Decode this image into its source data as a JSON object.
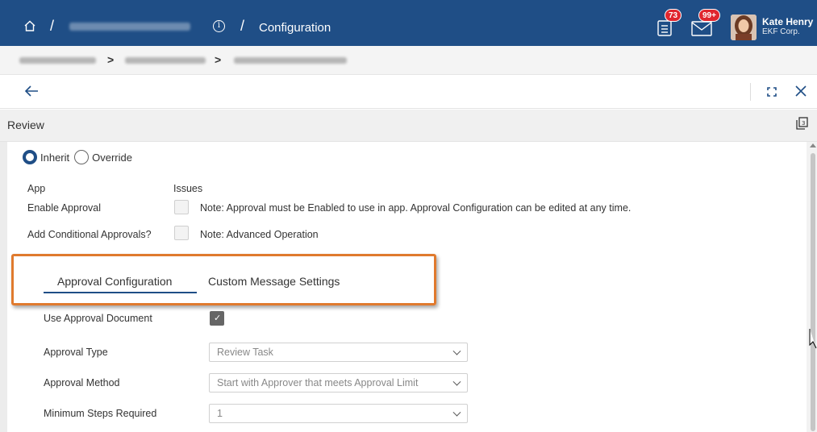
{
  "header": {
    "breadcrumb_current": "Configuration",
    "notifications_count": "73",
    "messages_count": "99+",
    "user_name": "Kate Henry",
    "user_company": "EKF Corp."
  },
  "section": {
    "title": "Review"
  },
  "inherit": {
    "inherit_label": "Inherit",
    "override_label": "Override"
  },
  "form_top": {
    "app_label": "App",
    "issues_label": "Issues",
    "enable_approval_label": "Enable Approval",
    "enable_approval_note": "Note:  Approval must be Enabled to use in app.  Approval Configuration can be edited at any time.",
    "conditional_label": "Add Conditional Approvals?",
    "conditional_note": "Note:  Advanced Operation"
  },
  "tabs": [
    {
      "label": "Approval Configuration"
    },
    {
      "label": "Custom Message Settings"
    }
  ],
  "config": {
    "use_doc_label": "Use Approval Document",
    "approval_type_label": "Approval Type",
    "approval_type_value": "Review Task",
    "approval_method_label": "Approval Method",
    "approval_method_value": "Start with Approver that meets Approval Limit",
    "min_steps_label": "Minimum Steps Required",
    "min_steps_value": "1"
  },
  "colors": {
    "brand": "#1f4e86",
    "highlight": "#e07a2e",
    "badge": "#e0262e"
  }
}
